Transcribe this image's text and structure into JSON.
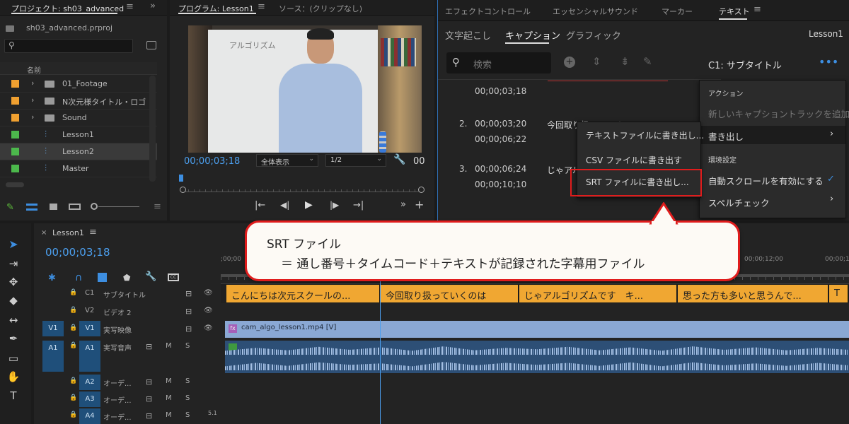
{
  "project": {
    "tab": "プロジェクト: sh03_advanced",
    "file": "sh03_advanced.prproj",
    "col_name": "名前",
    "items": [
      {
        "label": "01_Footage",
        "color": "#f0a030",
        "kind": "bin"
      },
      {
        "label": "N次元様タイトル・ロゴ",
        "color": "#f0a030",
        "kind": "bin"
      },
      {
        "label": "Sound",
        "color": "#f0a030",
        "kind": "bin"
      },
      {
        "label": "Lesson1",
        "color": "#4cb84c",
        "kind": "seq"
      },
      {
        "label": "Lesson2",
        "color": "#4cb84c",
        "kind": "seq"
      },
      {
        "label": "Master",
        "color": "#4cb84c",
        "kind": "seq"
      }
    ]
  },
  "program": {
    "tab": "プログラム: Lesson1",
    "tab2": "ソース：(クリップなし)",
    "timecode": "00;00;03;18",
    "zoom": "全体表示",
    "resolution": "1/2",
    "right_tc": "00",
    "board_text": "アルゴリズム"
  },
  "text_panel": {
    "tabs": [
      "エフェクトコントロール",
      "エッセンシャルサウンド",
      "マーカー",
      "テキスト"
    ],
    "subtabs": [
      "文字起こし",
      "キャプション",
      "グラフィック"
    ],
    "seq": "Lesson1",
    "search_placeholder": "検索",
    "track_label": "C1: サブタイトル",
    "captions": [
      {
        "num": "",
        "in": "",
        "out": "00;00;03;18",
        "text": ""
      },
      {
        "num": "2.",
        "in": "00;00;03;20",
        "out": "00;00;06;22",
        "text": "今回取り扱っていくの"
      },
      {
        "num": "3.",
        "in": "00;00;06;24",
        "out": "00;00;10;10",
        "text": "じゃアル"
      }
    ]
  },
  "menu_main": {
    "h_action": "アクション",
    "new_track": "新しいキャプショントラックを追加...",
    "export": "書き出し",
    "h_env": "環境設定",
    "autoscroll": "自動スクロールを有効にする",
    "spell": "スペルチェック"
  },
  "menu_sub": {
    "txt": "テキストファイルに書き出し...",
    "csv": "CSV ファイルに書き出す",
    "srt": "SRT ファイルに書き出し..."
  },
  "callout": {
    "line1": "SRT ファイル",
    "line2": "＝ 通し番号＋タイムコード＋テキストが記録された字幕用ファイル"
  },
  "timeline": {
    "tab": "Lesson1",
    "timecode": "00;00;03;18",
    "ruler_left": ";00;00",
    "ruler_right": "00;00;12;00",
    "ruler_far": "00;00;1",
    "tracks": [
      {
        "lock": "🔒",
        "id": "C1",
        "name": "サブタイトル"
      },
      {
        "lock": "🔒",
        "id": "V2",
        "name": "ビデオ 2"
      },
      {
        "lock": "🔒",
        "id": "V1",
        "name": "実写映像"
      },
      {
        "lock": "🔒",
        "id": "A1",
        "name": "実写音声"
      },
      {
        "lock": "🔒",
        "id": "A2",
        "name": "オーデ..."
      },
      {
        "lock": "🔒",
        "id": "A3",
        "name": "オーデ..."
      },
      {
        "lock": "🔒",
        "id": "A4",
        "name": "オーデ..."
      }
    ],
    "src_v": "V1",
    "src_a": "A1",
    "m": "M",
    "s": "S",
    "channel": "5.1",
    "captions": [
      "こんにちは次元スクールの...",
      "今回取り扱っていくのは",
      "じゃアルゴリズムです　キ...",
      "思った方も多いと思うんで...",
      "T"
    ],
    "video_clip": "cam_algo_lesson1.mp4 [V]",
    "fx": "fx"
  }
}
